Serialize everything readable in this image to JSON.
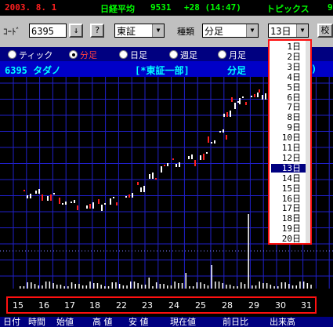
{
  "topbar": {
    "date": "2003. 8. 1",
    "index_label": "日経平均",
    "index_value": "9531",
    "index_change": "+28 (14:47)",
    "topics": "トピックス",
    "topics_value": "9"
  },
  "controls": {
    "code_label": "ｺｰﾄﾞ",
    "code_value": "6395",
    "down_arrow": "↓",
    "help": "?",
    "market_value": "東証",
    "type_label": "種類",
    "type_value": "分足",
    "days_value": "13日",
    "extra_button": "校"
  },
  "periods": [
    {
      "label": "ティック",
      "selected": false
    },
    {
      "label": "分足",
      "selected": true
    },
    {
      "label": "日足",
      "selected": false
    },
    {
      "label": "週足",
      "selected": false
    },
    {
      "label": "月足",
      "selected": false
    }
  ],
  "stock": {
    "code_name": "6395 タダノ",
    "market": "[*東証一部]",
    "type": "分足",
    "tail": ")"
  },
  "days_dropdown": {
    "items": [
      "1日",
      "2日",
      "3日",
      "4日",
      "5日",
      "6日",
      "7日",
      "8日",
      "9日",
      "10日",
      "11日",
      "12日",
      "13日",
      "14日",
      "15日",
      "16日",
      "17日",
      "18日",
      "19日",
      "20日"
    ],
    "selected": "13日"
  },
  "day_axis": [
    "15",
    "16",
    "17",
    "18",
    "22",
    "23",
    "24",
    "25",
    "28",
    "29",
    "30",
    "31"
  ],
  "columns": [
    "日付",
    "時間",
    "始値",
    "高 値",
    "安 値",
    "現在値",
    "前日比",
    "出来高"
  ],
  "colors": {
    "grid": "#2020c8",
    "candle_up": "#ffffff",
    "candle_down": "#ff2020",
    "volume": "#ffffff",
    "highlight": "#ff1010"
  }
}
